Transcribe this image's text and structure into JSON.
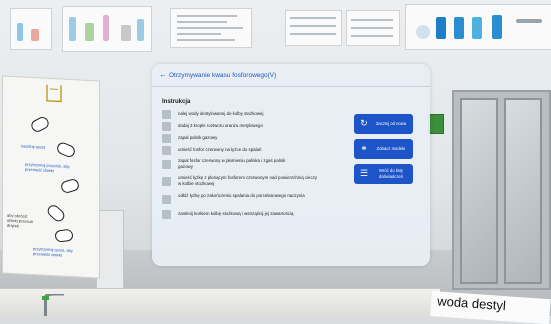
{
  "dialog": {
    "back_icon": "arrow-left-icon",
    "title": "Otrzymywanie kwasu fosforowego(V)",
    "section_title": "Instrukcja",
    "steps": [
      "nalej wody destylowanej do kolby stożkowej",
      "dodaj 2 krople roztworu oranżu metylowego",
      "zapal palnik gazowy",
      "umieść fosfor czerwony na łyżce do spalań",
      "zapal fosfor czerwony w płomieniu palnika i zgaś palnik gazowy",
      "umieść łyżkę z płonącym fosforem czerwonym nad powierzchnią cieczy w kolbie stożkowej",
      "odłóż łyżkę po zakończeniu spalania do porcelanowego naczynia",
      "zamknij korkiem kolbę stożkową i wstrząśnij jej zawartością"
    ],
    "buttons": [
      {
        "label": "Zacznij od nowa",
        "icon": "restart-icon"
      },
      {
        "label": "Zobacz modele",
        "icon": "molecule-icon"
      },
      {
        "label": "Wróć do listy doświadczeń",
        "icon": "list-icon"
      }
    ]
  },
  "tutorial": {
    "captions": [
      "naciśnij spust",
      "przytrzymaj przycisk, aby przenieść obiekt",
      "aby obrócić obiekt przesuń drążek",
      "przytrzymaj spust, aby przenieść obiekt"
    ]
  },
  "sign_text": "woda destyl"
}
